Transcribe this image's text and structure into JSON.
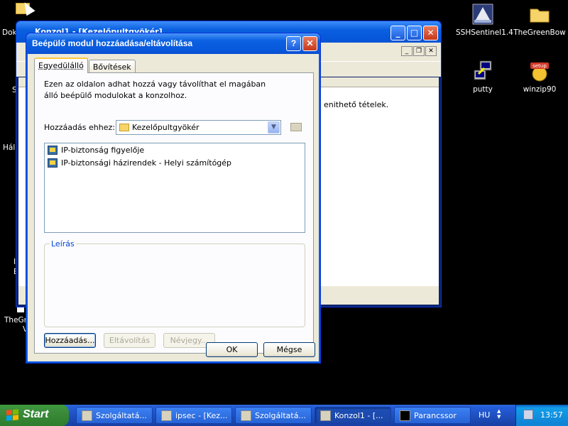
{
  "desktop": {
    "icons": [
      {
        "label": "SSHSentinel1.4",
        "icon": "ssh-sentinel-icon"
      },
      {
        "label": "TheGreenBow",
        "icon": "folder-icon"
      },
      {
        "label": "putty",
        "icon": "putty-icon"
      },
      {
        "label": "winzip90",
        "icon": "setup-icon"
      }
    ],
    "left_partial_labels": [
      "Dok",
      "S",
      "Hál",
      "I",
      "E",
      "TheGre",
      "V"
    ]
  },
  "background_window": {
    "title": "Konzol1 - [Kezelőpultgyökér]",
    "content_text": "enithető tételek."
  },
  "dialog": {
    "title": "Beépülő modul hozzáadása/eltávolítása",
    "help_glyph": "?",
    "close_glyph": "✕",
    "tabs": [
      {
        "label": "Egyedülálló",
        "active": true
      },
      {
        "label": "Bővítések",
        "active": false
      }
    ],
    "description": "Ezen az oldalon adhat hozzá vagy távolíthat el magában álló beépülő modulokat a konzolhoz.",
    "add_to_label": "Hozzáadás ehhez:",
    "add_to_value": "Kezelőpultgyökér",
    "snapins": [
      "IP-biztonság figyelője",
      "IP-biztonsági házirendek - Helyi számítógép"
    ],
    "description_group_label": "Leírás",
    "buttons": {
      "add": "Hozzáadás...",
      "remove": "Eltávolítás",
      "about": "Névjegy...",
      "ok": "OK",
      "cancel": "Mégse"
    }
  },
  "taskbar": {
    "start_label": "Start",
    "tasks": [
      {
        "label": "Szolgáltatá...",
        "active": false
      },
      {
        "label": "ipsec - [Kez...",
        "active": false
      },
      {
        "label": "Szolgáltatá...",
        "active": false
      },
      {
        "label": "Konzol1 - [...",
        "active": true
      },
      {
        "label": "Parancssor",
        "active": false
      }
    ],
    "language": "HU",
    "clock": "13:57"
  },
  "colors": {
    "xp_blue": "#0a5fe0",
    "start_green": "#3c8c3c",
    "dialog_face": "#ece9d8"
  }
}
